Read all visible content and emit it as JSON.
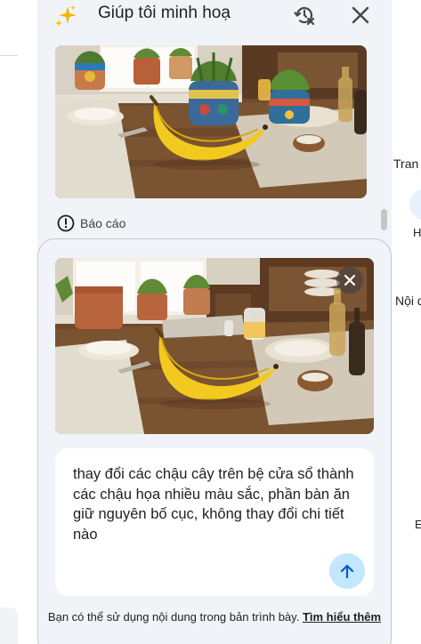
{
  "panel": {
    "title": "Giúp tôi minh hoạ",
    "icons": {
      "spark": "sparkle-icon",
      "history": "history-off-icon",
      "close": "close-icon"
    }
  },
  "generated_image": {
    "description": "Bàn gỗ với quả chuối, chậu cây trên bệ cửa sổ",
    "report_label": "Báo cáo"
  },
  "reference_image": {
    "description": "Bàn gỗ với quả chuối, chậu đất nung trên bệ cửa sổ"
  },
  "prompt": {
    "text": "thay đổi các chậu cây trên bệ cửa sổ thành các chậu họa nhiều màu sắc, phần bàn ăn giữ nguyên bố cục, không thay đổi chi tiết nào"
  },
  "footer": {
    "text": "Bạn có thể sử dụng nội dung trong bản trình bày.",
    "link": "Tìm hiểu thêm"
  },
  "right_panel": {
    "label_1": "Tran",
    "label_2": "H",
    "label_3": "Nội d",
    "label_4": "E"
  },
  "colors": {
    "panel_bg": "#f0f4f9",
    "send_button": "#c2e7ff",
    "text": "#1f1f1f"
  }
}
